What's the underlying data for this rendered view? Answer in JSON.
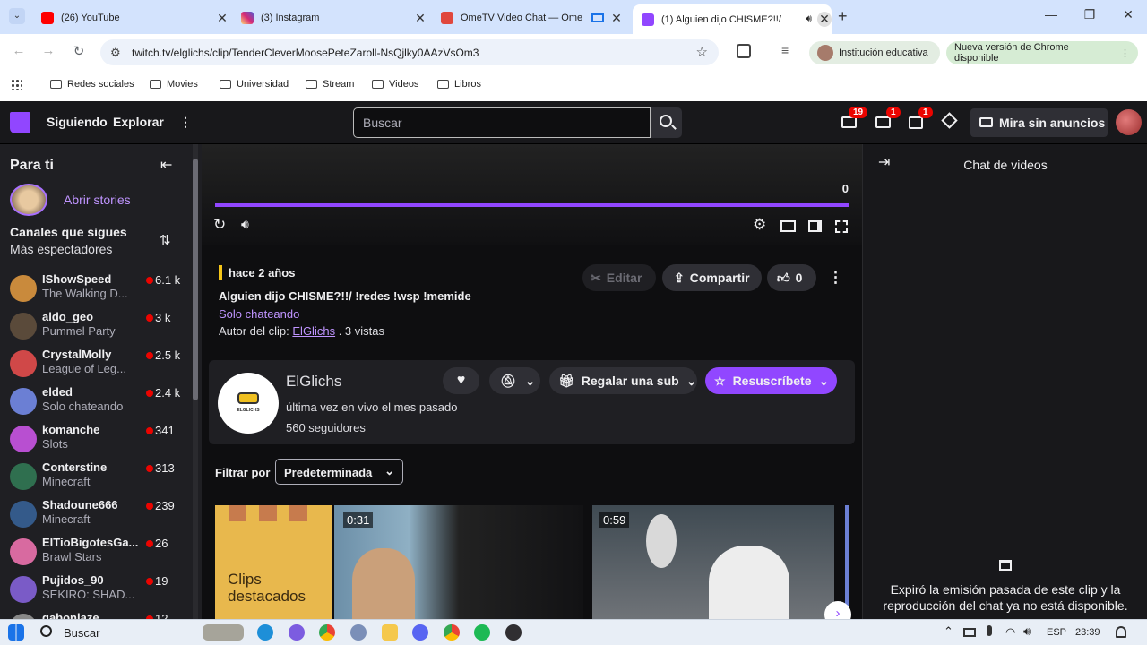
{
  "browser": {
    "tabs": [
      {
        "title": "(26) YouTube",
        "favicon_color": "#ff0000"
      },
      {
        "title": "(3) Instagram",
        "favicon_color": "#d62976"
      },
      {
        "title": "OmeTV Video Chat — Ome",
        "favicon_color": "#e0473d"
      },
      {
        "title": "(1) Alguien dijo CHISME?!!/",
        "favicon_color": "#9146ff"
      }
    ],
    "new_tab_symbol": "+",
    "url": "twitch.tv/elglichs/clip/TenderCleverMoosePeteZaroll-NsQjlky0AAzVsOm3",
    "profile_label": "Institución educativa",
    "update_label": "Nueva versión de Chrome disponible",
    "bookmarks": [
      "Redes sociales",
      "Movies",
      "Universidad",
      "Stream",
      "Videos",
      "Libros"
    ]
  },
  "twitch": {
    "nav": {
      "following": "Siguiendo",
      "explore": "Explorar",
      "search_placeholder": "Buscar",
      "badge_inbox": "19",
      "badge_whispers": "1",
      "badge_notif": "1",
      "no_ads": "Mira sin anuncios"
    },
    "sidebar": {
      "title": "Para ti",
      "stories": "Abrir stories",
      "followed_title": "Canales que sigues",
      "followed_sub": "Más espectadores",
      "channels": [
        {
          "name": "IShowSpeed",
          "game": "The Walking D...",
          "viewers": "6.1 k",
          "color": "#c98a3c"
        },
        {
          "name": "aldo_geo",
          "game": "Pummel Party",
          "viewers": "3 k",
          "color": "#5a4a3a"
        },
        {
          "name": "CrystalMolly",
          "game": "League of Leg...",
          "viewers": "2.5 k",
          "color": "#d04848"
        },
        {
          "name": "elded",
          "game": "Solo chateando",
          "viewers": "2.4 k",
          "color": "#6b7fd4"
        },
        {
          "name": "komanche",
          "game": "Slots",
          "viewers": "341",
          "color": "#b84fd1"
        },
        {
          "name": "Conterstine",
          "game": "Minecraft",
          "viewers": "313",
          "color": "#2f6f4f"
        },
        {
          "name": "Shadoune666",
          "game": "Minecraft",
          "viewers": "239",
          "color": "#345a8a"
        },
        {
          "name": "ElTioBigotesGa...",
          "game": "Brawl Stars",
          "viewers": "26",
          "color": "#d86aa0"
        },
        {
          "name": "Pujidos_90",
          "game": "SEKIRO: SHAD...",
          "viewers": "19",
          "color": "#7a5bc7"
        },
        {
          "name": "gabonlaze",
          "game": "",
          "viewers": "12",
          "color": "#888888"
        }
      ]
    },
    "player": {
      "time": "0",
      "progress": 1.0
    },
    "clip": {
      "age": "hace 2 años",
      "title": "Alguien dijo CHISME?!!/ !redes !wsp !memide",
      "category": "Solo chateando",
      "author_prefix": "Autor del clip:",
      "author": "ElGlichs",
      "views": ". 3 vistas",
      "edit": "Editar",
      "share": "Compartir",
      "likes": "0"
    },
    "channel": {
      "name": "ElGlichs",
      "last_live": "última vez en vivo el mes pasado",
      "followers": "560 seguidores",
      "gift": "Regalar una sub",
      "resub": "Resuscríbete",
      "logo_text": "ELGLICHS"
    },
    "filter": {
      "label": "Filtrar por",
      "value": "Predeterminada"
    },
    "clips": {
      "featured_label": "Clips destacados",
      "durations": [
        "0:31",
        "0:59"
      ]
    },
    "chat": {
      "title": "Chat de videos",
      "expired": "Expiró la emisión pasada de este clip y la reproducción del chat ya no está disponible."
    }
  },
  "taskbar": {
    "search": "Buscar",
    "lang": "ESP",
    "time": "23:39"
  }
}
